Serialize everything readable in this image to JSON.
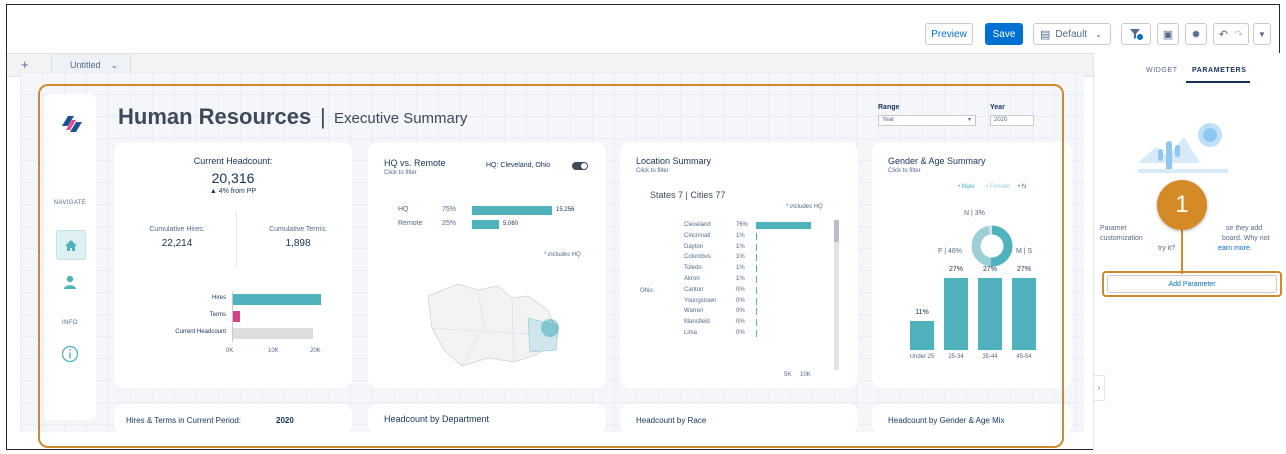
{
  "toolbar": {
    "preview_label": "Preview",
    "save_label": "Save",
    "layout_label": "Default"
  },
  "tabs": {
    "add_label": "+",
    "current_label": "Untitled"
  },
  "dashboard": {
    "title": "Human Resources",
    "separator": "|",
    "subtitle": "Executive Summary",
    "range": {
      "label": "Range",
      "value": "Year"
    },
    "year": {
      "label": "Year",
      "value": "2020"
    }
  },
  "nav": {
    "navigate_label": "NAVIGATE",
    "info_label": "INFO"
  },
  "headcount_card": {
    "title": "Current Headcount:",
    "value": "20,316",
    "change": "▲ 4% from PP",
    "hires_label": "Cumulative Hires:",
    "hires_value": "22,214",
    "terms_label": "Cumulative Terms:",
    "terms_value": "1,898",
    "bars": [
      {
        "label": "Hires",
        "value": 22214,
        "color": "#4fb2bc"
      },
      {
        "label": "Terms",
        "value": 1898,
        "color": "#d6418a"
      },
      {
        "label": "Current Headcount",
        "value": 20316,
        "color": "#dddddd"
      }
    ],
    "ticks": [
      "0K",
      "10K",
      "20K"
    ]
  },
  "hq_card": {
    "title": "HQ vs. Remote",
    "subtitle": "Click to filter",
    "toggle_label": "HQ: Cleveland, Ohio",
    "rows": [
      {
        "label": "HQ",
        "pct": "75%",
        "value": "15,256",
        "fraction": 0.75
      },
      {
        "label": "Remote",
        "pct": "25%",
        "value": "5,060",
        "fraction": 0.25
      }
    ],
    "note": "* includes HQ"
  },
  "location_card": {
    "title": "Location Summary",
    "subtitle": "Click to filter",
    "summary": "States 7 | Cities 77",
    "note": "* includes HQ",
    "state": "Ohio",
    "cities": [
      {
        "name": "Cleveland",
        "pct": "76%",
        "fraction": 0.76
      },
      {
        "name": "Cincinnati",
        "pct": "1%",
        "fraction": 0.01
      },
      {
        "name": "Dayton",
        "pct": "1%",
        "fraction": 0.01
      },
      {
        "name": "Columbus",
        "pct": "1%",
        "fraction": 0.01
      },
      {
        "name": "Toledo",
        "pct": "1%",
        "fraction": 0.01
      },
      {
        "name": "Akron",
        "pct": "1%",
        "fraction": 0.01
      },
      {
        "name": "Canton",
        "pct": "0%",
        "fraction": 0.0
      },
      {
        "name": "Youngstown",
        "pct": "0%",
        "fraction": 0.0
      },
      {
        "name": "Warren",
        "pct": "0%",
        "fraction": 0.0
      },
      {
        "name": "Mansfield",
        "pct": "0%",
        "fraction": 0.0
      },
      {
        "name": "Lima",
        "pct": "0%",
        "fraction": 0.0
      }
    ],
    "ticks": [
      "5K",
      "10K"
    ]
  },
  "gender_card": {
    "title": "Gender & Age Summary",
    "subtitle": "Click to filter",
    "legend": [
      "• Male",
      "• Female",
      "• N"
    ],
    "donut_labels": {
      "top": "N | 3%",
      "left": "F | 46%",
      "right": "M | S"
    },
    "age_bars": [
      {
        "label": "Under 25",
        "pct": "11%",
        "value": 11
      },
      {
        "label": "25-34",
        "pct": "27%",
        "value": 27
      },
      {
        "label": "35-44",
        "pct": "27%",
        "value": 27
      },
      {
        "label": "45-54",
        "pct": "27%",
        "value": 27
      }
    ]
  },
  "bottom_cards": [
    {
      "title": "Hires & Terms in Current Period:",
      "extra": "2020"
    },
    {
      "title": "Headcount by Department",
      "extra": ""
    },
    {
      "title": "Headcount by Race",
      "extra": ""
    },
    {
      "title": "Headcount by Gender & Age Mix",
      "extra": ""
    }
  ],
  "right_panel": {
    "tab_widget": "WIDGET",
    "tab_parameters": "PARAMETERS",
    "description_1": "Paramet",
    "description_1b": "se they add",
    "description_2": "customization",
    "description_2b": "board. Why not",
    "description_3": "try it?",
    "learn_more": "earn more.",
    "add_button": "Add Parameter"
  },
  "callout": {
    "number": "1"
  },
  "colors": {
    "teal": "#4fb2bc",
    "pink": "#d6418a",
    "orange": "#d08a2e",
    "blue": "#0070d2"
  }
}
